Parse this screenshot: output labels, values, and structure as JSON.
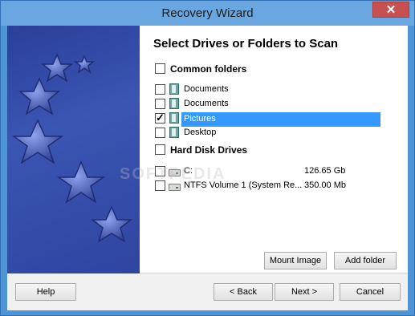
{
  "window": {
    "title": "Recovery Wizard",
    "close_glyph": "✕"
  },
  "heading": "Select Drives or Folders to Scan",
  "sections": {
    "common": {
      "label": "Common folders",
      "checked": false
    },
    "hard": {
      "label": "Hard Disk Drives",
      "checked": false
    }
  },
  "folders": [
    {
      "label": "Documents",
      "checked": false,
      "icon": "documents-folder-icon"
    },
    {
      "label": "Documents",
      "checked": false,
      "icon": "documents-folder-icon"
    },
    {
      "label": "Pictures",
      "checked": true,
      "icon": "pictures-folder-icon",
      "selected": true
    },
    {
      "label": "Desktop",
      "checked": false,
      "icon": "desktop-folder-icon"
    }
  ],
  "drives": [
    {
      "name": "C:",
      "size": "126.65 Gb",
      "checked": false,
      "icon": "hard-drive-icon"
    },
    {
      "name": "NTFS Volume 1 (System Re...",
      "size": "350.00 Mb",
      "checked": false,
      "icon": "hard-drive-icon"
    }
  ],
  "buttons": {
    "mount": "Mount Image",
    "add_folder": "Add folder",
    "help": "Help",
    "back": "< Back",
    "next": "Next >",
    "cancel": "Cancel"
  },
  "watermark": "SOFTPEDIA",
  "colors": {
    "selection": "#3399ff",
    "titlebar": "#6aa6df",
    "close": "#c75050",
    "sidebar": "#3b55b2"
  }
}
